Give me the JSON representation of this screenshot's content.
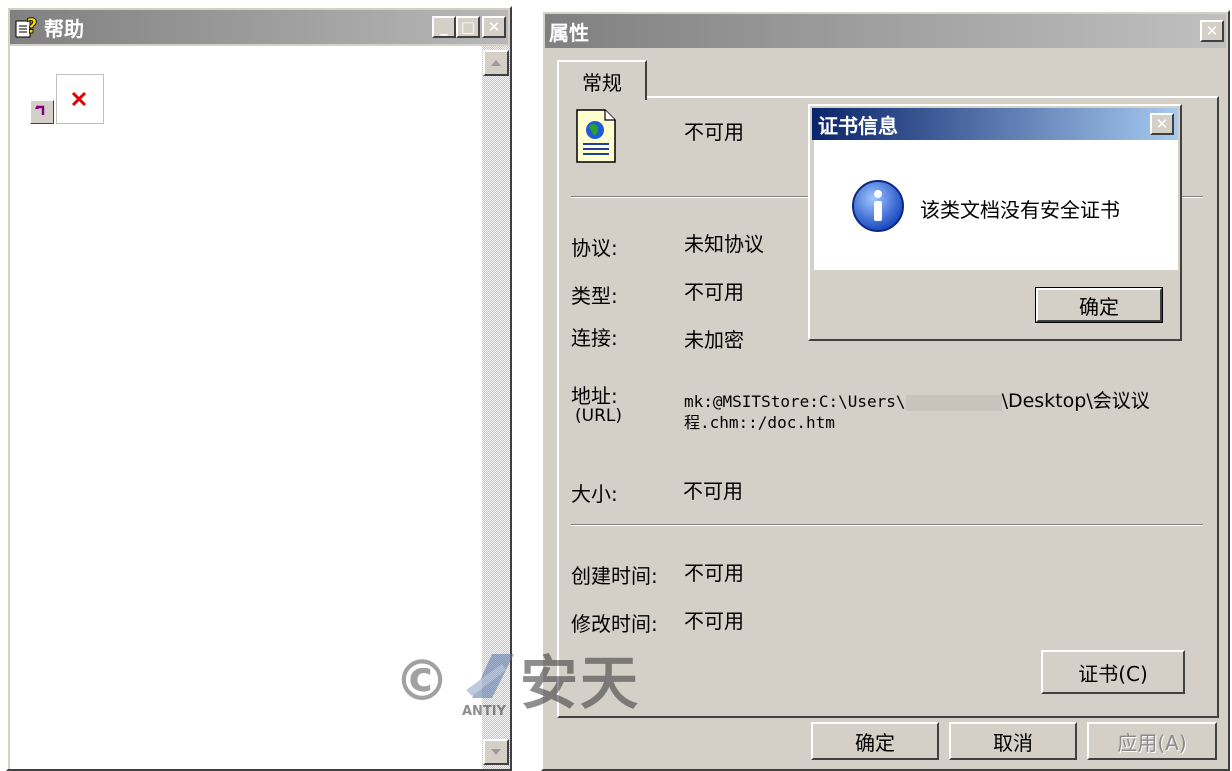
{
  "help_window": {
    "title": "帮助",
    "controls": {
      "minimize": "_",
      "maximize": "□",
      "close": "✕"
    }
  },
  "properties_window": {
    "title": "属性",
    "close": "✕",
    "tab": "常规",
    "file_name": "不可用",
    "fields": {
      "protocol_label": "协议:",
      "protocol_value": "未知协议",
      "type_label": "类型:",
      "type_value": "不可用",
      "connection_label": "连接:",
      "connection_value": "未加密",
      "address_label": "地址:",
      "address_label_sub": "(URL)",
      "address_line1_prefix": "mk:@MSITStore:C:\\Users\\",
      "address_line1_suffix": "\\Desktop\\会议议",
      "address_line2": "程.chm::/doc.htm",
      "size_label": "大小:",
      "size_value": "不可用",
      "created_label": "创建时间:",
      "created_value": "不可用",
      "modified_label": "修改时间:",
      "modified_value": "不可用"
    },
    "certificate_button": "证书(C)",
    "ok_button": "确定",
    "cancel_button": "取消",
    "apply_button": "应用(A)"
  },
  "cert_dialog": {
    "title": "证书信息",
    "close": "✕",
    "message": "该类文档没有安全证书",
    "ok_button": "确定"
  },
  "watermark": {
    "copyright": "©",
    "brand_small": "ANTIY",
    "brand": "安天"
  },
  "colors": {
    "face": "#d4d0c8",
    "active_title_start": "#0a246a",
    "active_title_end": "#a6caf0",
    "inactive_title": "#808080"
  }
}
